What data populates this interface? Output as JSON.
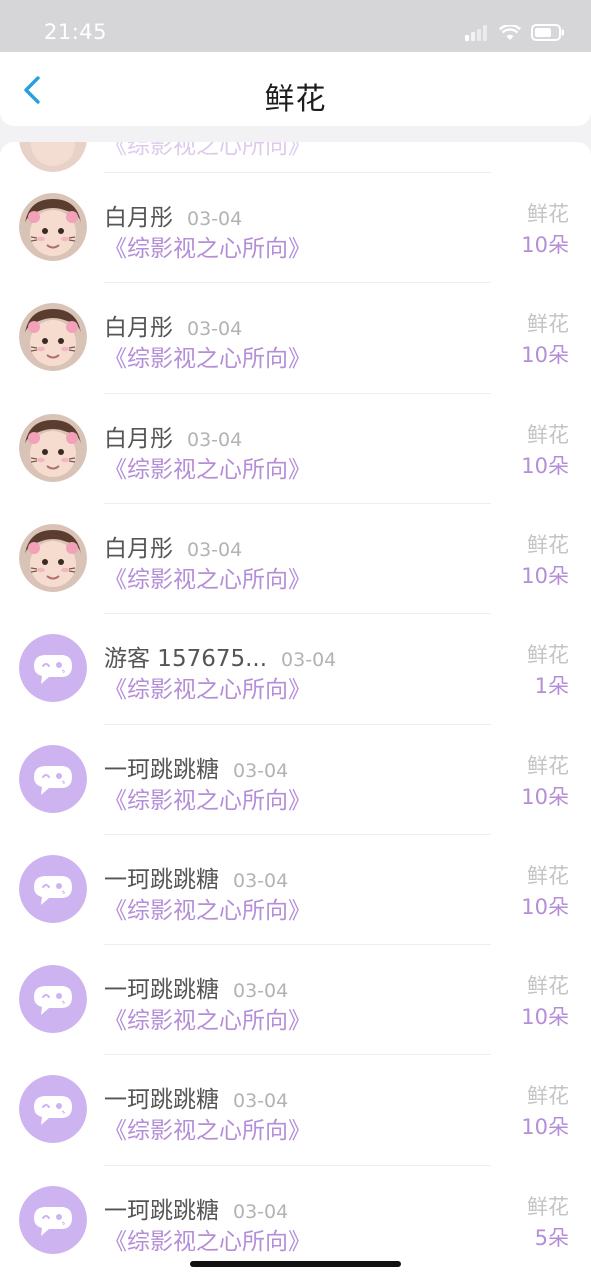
{
  "status": {
    "time": "21:45"
  },
  "header": {
    "title": "鲜花"
  },
  "colors": {
    "accent": "#b58ed8",
    "avatar_bg": "#cdb4f0",
    "back_arrow": "#2a9fe0"
  },
  "rows": [
    {
      "name": "白月彤",
      "date": "03-04",
      "book": "《综影视之心所向》",
      "gift": "鲜花",
      "count": "10朵",
      "avatar": "photo"
    },
    {
      "name": "白月彤",
      "date": "03-04",
      "book": "《综影视之心所向》",
      "gift": "鲜花",
      "count": "10朵",
      "avatar": "photo"
    },
    {
      "name": "白月彤",
      "date": "03-04",
      "book": "《综影视之心所向》",
      "gift": "鲜花",
      "count": "10朵",
      "avatar": "photo"
    },
    {
      "name": "白月彤",
      "date": "03-04",
      "book": "《综影视之心所向》",
      "gift": "鲜花",
      "count": "10朵",
      "avatar": "photo"
    },
    {
      "name": "游客 157675...",
      "date": "03-04",
      "book": "《综影视之心所向》",
      "gift": "鲜花",
      "count": "1朵",
      "avatar": "default"
    },
    {
      "name": "一珂跳跳糖",
      "date": "03-04",
      "book": "《综影视之心所向》",
      "gift": "鲜花",
      "count": "10朵",
      "avatar": "default"
    },
    {
      "name": "一珂跳跳糖",
      "date": "03-04",
      "book": "《综影视之心所向》",
      "gift": "鲜花",
      "count": "10朵",
      "avatar": "default"
    },
    {
      "name": "一珂跳跳糖",
      "date": "03-04",
      "book": "《综影视之心所向》",
      "gift": "鲜花",
      "count": "10朵",
      "avatar": "default"
    },
    {
      "name": "一珂跳跳糖",
      "date": "03-04",
      "book": "《综影视之心所向》",
      "gift": "鲜花",
      "count": "10朵",
      "avatar": "default"
    },
    {
      "name": "一珂跳跳糖",
      "date": "03-04",
      "book": "《综影视之心所向》",
      "gift": "鲜花",
      "count": "5朵",
      "avatar": "default"
    }
  ],
  "partial_row": {
    "book": "《综影视之心所向》"
  }
}
